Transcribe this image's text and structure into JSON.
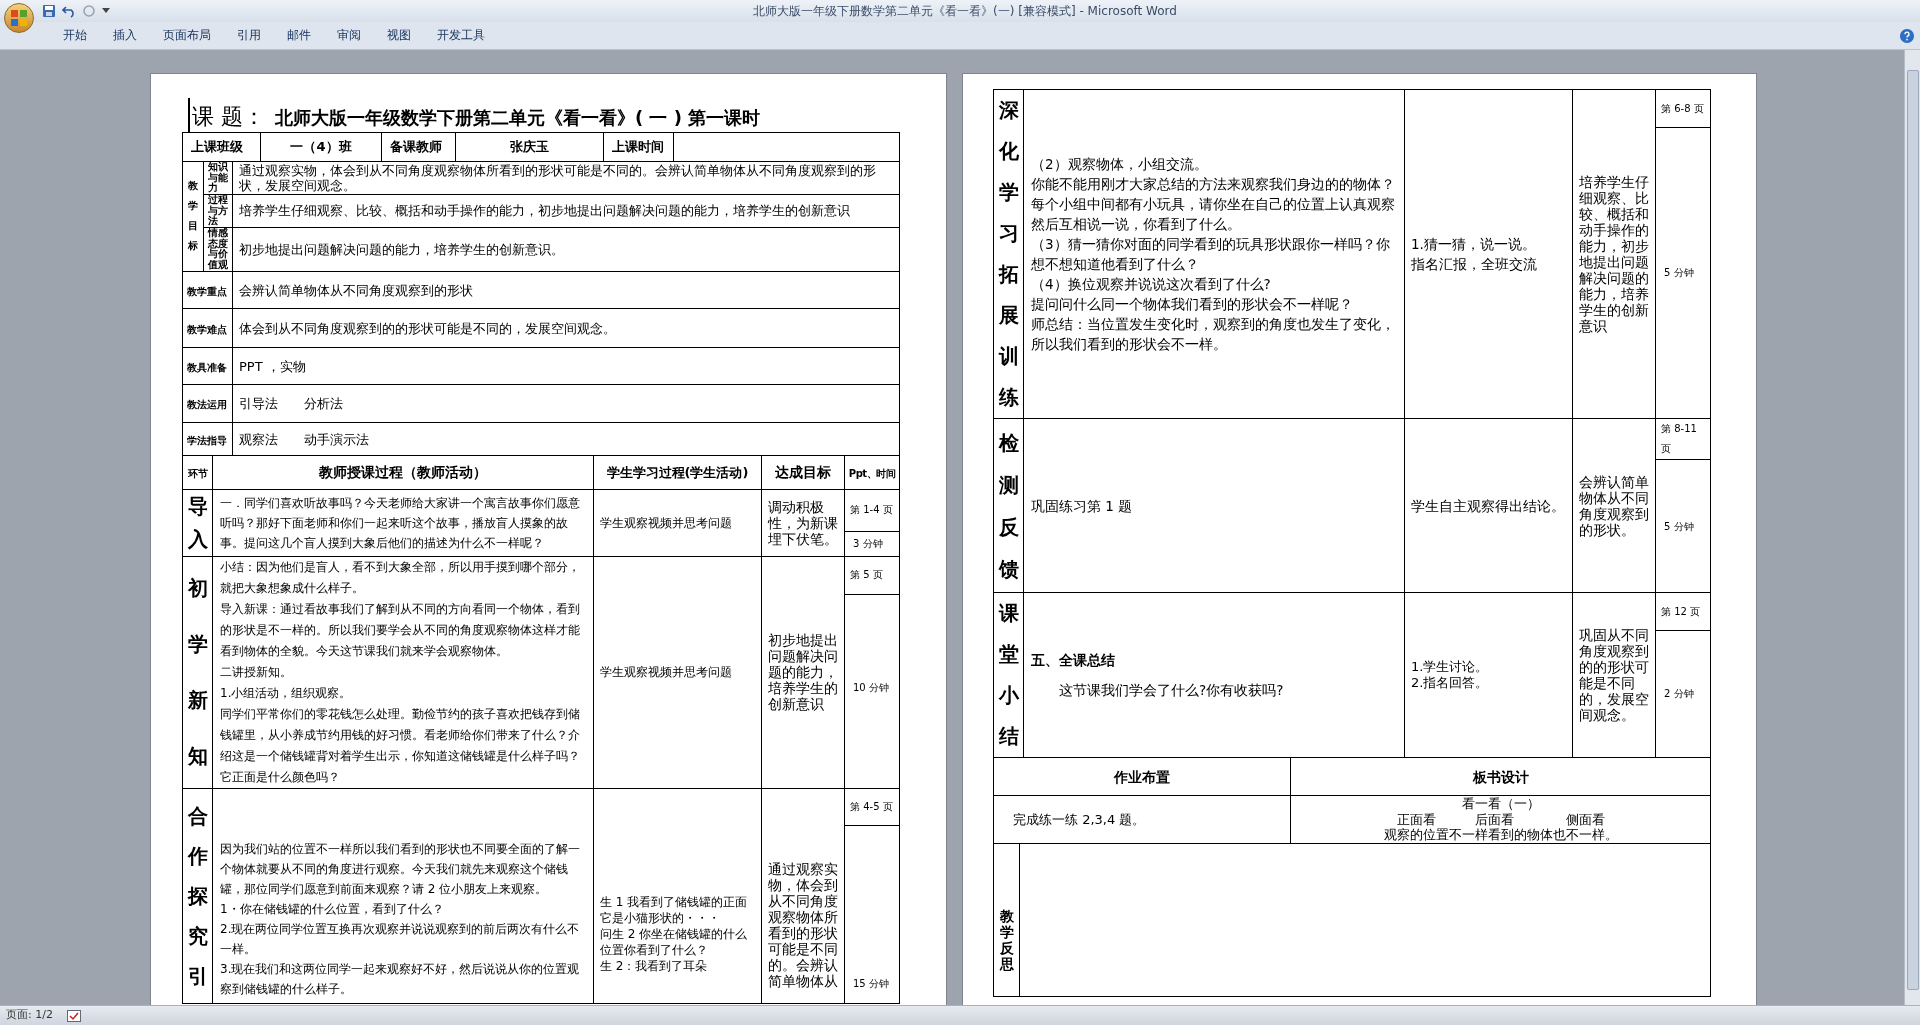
{
  "window": {
    "title": "北师大版一年级下册数学第二单元《看一看》(一) [兼容模式] - Microsoft Word"
  },
  "ribbon_tabs": [
    {
      "label": "开始"
    },
    {
      "label": "插入"
    },
    {
      "label": "页面布局"
    },
    {
      "label": "引用"
    },
    {
      "label": "邮件"
    },
    {
      "label": "审阅"
    },
    {
      "label": "视图"
    },
    {
      "label": "开发工具"
    }
  ],
  "left_page": {
    "title_label": "课 题：",
    "title": "北师大版一年级数学下册第二单元《看一看》( 一 ) 第一课时",
    "info_row": [
      {
        "text": "上课班级",
        "kind": "label"
      },
      {
        "text": "一（4）班",
        "kind": "value"
      },
      {
        "text": "备课教师",
        "kind": "label"
      },
      {
        "text": "张庆玉",
        "kind": "value"
      },
      {
        "text": "上课时间",
        "kind": "label"
      }
    ],
    "objectives": {
      "label": "教学目标",
      "items": [
        {
          "label": "知识与能力",
          "text": "通过观察实物，体会到从不同角度观察物体所看到的形状可能是不同的。会辨认简单物体从不同角度观察到的形状，发展空间观念。"
        },
        {
          "label": "过程与方法",
          "text": "培养学生仔细观察、比较、概括和动手操作的能力，初步地提出问题解决问题的能力，培养学生的创新意识"
        },
        {
          "label": "情感态度与价值观",
          "text": "初步地提出问题解决问题的能力，培养学生的创新意识。"
        }
      ]
    },
    "info_rows": [
      {
        "label": "教学重点",
        "text": "会辨认简单物体从不同角度观察到的形状"
      },
      {
        "label": "教学难点",
        "text": "体会到从不同角度观察到的的形状可能是不同的，发展空间观念。"
      },
      {
        "label": "教具准备",
        "text": "PPT ，实物"
      },
      {
        "label": "教法运用",
        "text": "引导法　　分析法"
      },
      {
        "label": "学法指导",
        "text": "观察法　　动手演示法"
      }
    ],
    "process_header": [
      "环节",
      "教师授课过程（教师活动）",
      "学生学习过程(学生活动)",
      "达成目标",
      "Ppt、时间"
    ],
    "stages": [
      {
        "label": "导入",
        "teacher": [
          {
            "text": "一．同学们喜欢听故事吗？今天老师给大家讲一个寓言故事你们愿意听吗？那好下面老师和你们一起来听这个故事，播放盲人摸象的故事。提问这几个盲人摸到大象后他们的描述为什么不一样呢？"
          }
        ],
        "student": [
          "学生观察视频并思考问题"
        ],
        "goal": "调动积极性，为新课埋下伏笔。",
        "page": "第 1-4 页",
        "time": "3 分钟"
      },
      {
        "label": "初学新知",
        "teacher": [
          {
            "text": "小结：因为他们是盲人，看不到大象全部，所以用手摸到哪个部分，就把大象想象成什么样子。"
          },
          {
            "text": "导入新课：通过看故事我们了解到从不同的方向看同一个物体，看到的形状是不一样的。所以我们要学会从不同的角度观察物体这样才能看到物体的全貌。今天这节课我们就来学会观察物体。"
          },
          {
            "text": "二讲授新知。"
          },
          {
            "text": "1.小组活动，组织观察。"
          },
          {
            "text": "同学们平常你们的零花钱怎么处理。勤俭节约的孩子喜欢把钱存到储钱罐里，从小养成节约用钱的好习惯。看老师给你们带来了什么？介绍这是一个储钱罐背对着学生出示，你知道这储钱罐是什么样子吗？它正面是什么颜色吗？"
          }
        ],
        "student": [
          "学生观察视频并思考问题"
        ],
        "goal": "初步地提出问题解决问题的能力，培养学生的创新意识",
        "page": "第 5 页",
        "time": "10 分钟"
      },
      {
        "label": "合作探究引",
        "teacher": [
          {
            "text": "因为我们站的位置不一样所以我们看到的形状也不同要全面的了解一个物体就要从不同的角度进行观察。今天我们就先来观察这个储钱罐，那位同学们愿意到前面来观察？请 2 位小朋友上来观察。"
          },
          {
            "text": "1・你在储钱罐的什么位置，看到了什么？"
          },
          {
            "text": "2.现在两位同学位置互换再次观察并说说观察到的前后两次有什么不一样。"
          },
          {
            "text": "3.现在我们和这两位同学一起来观察好不好，然后说说从你的位置观察到储钱罐的什么样子。"
          }
        ],
        "student": [
          "生 1 我看到了储钱罐的正面它是小猫形状的・・・",
          "问生 2 你坐在储钱罐的什么位置你看到了什么？",
          "生 2：我看到了耳朵"
        ],
        "goal": "通过观察实物，体会到从不同角度观察物体所看到的形状可能是不同的。会辨认简单物体从",
        "page": "第 4-5 页",
        "time": "15 分钟"
      }
    ]
  },
  "right_page": {
    "stages": [
      {
        "label": "深化学习拓展训练",
        "teacher": [
          {
            "text": "（2）观察物体，小组交流。"
          },
          {
            "text": "你能不能用刚才大家总结的方法来观察我们身边的的物体？每个小组中间都有小玩具，请你坐在自己的位置上认真观察然后互相说一说，你看到了什么。"
          },
          {
            "text": "（3）猜一猜你对面的同学看到的玩具形状跟你一样吗？你想不想知道他看到了什么？"
          },
          {
            "text": "（4）换位观察并说说这次看到了什么?"
          },
          {
            "text": "提问问什么同一个物体我们看到的形状会不一样呢？"
          },
          {
            "text": "师总结：当位置发生变化时，观察到的角度也发生了变化，所以我们看到的形状会不一样。"
          }
        ],
        "student": [
          "1.猜一猜，说一说。",
          "指名汇报，全班交流"
        ],
        "goal": "培养学生仔细观察、比较、概括和动手操作的能力，初步地提出问题解决问题的能力，培养学生的创新意识",
        "page": "第 6-8 页",
        "time": "5 分钟"
      },
      {
        "label": "检测反馈",
        "teacher": [
          {
            "text": "巩固练习第 1 题"
          }
        ],
        "student": [
          "学生自主观察得出结论。"
        ],
        "goal": "会辨认简单物体从不同角度观察到的形状。",
        "page": "第 8-11 页",
        "time": "5 分钟"
      },
      {
        "label": "课堂小结",
        "teacher": [
          {
            "text": "五、全课总结",
            "bold": true
          },
          {
            "text": "这节课我们学会了什么?你有收获吗?",
            "bold": false
          }
        ],
        "student": [
          "1.学生讨论。",
          "2.指名回答。"
        ],
        "goal": "巩固从不同角度观察到的的形状可能是不同的，发展空间观念。",
        "page": "第 12 页",
        "time": "2 分钟"
      }
    ],
    "homework": {
      "heading": "作业布置",
      "text": "完成练一练 2,3,4 题。"
    },
    "board": {
      "heading": "板书设计",
      "lines": [
        "看一看（一）",
        "正面看　　　后面看　　　　侧面看",
        "观察的位置不一样看到的物体也不一样。"
      ]
    },
    "reflection": {
      "label": "教学反思"
    }
  },
  "status_bar": {
    "page": "页面: 1/2"
  }
}
